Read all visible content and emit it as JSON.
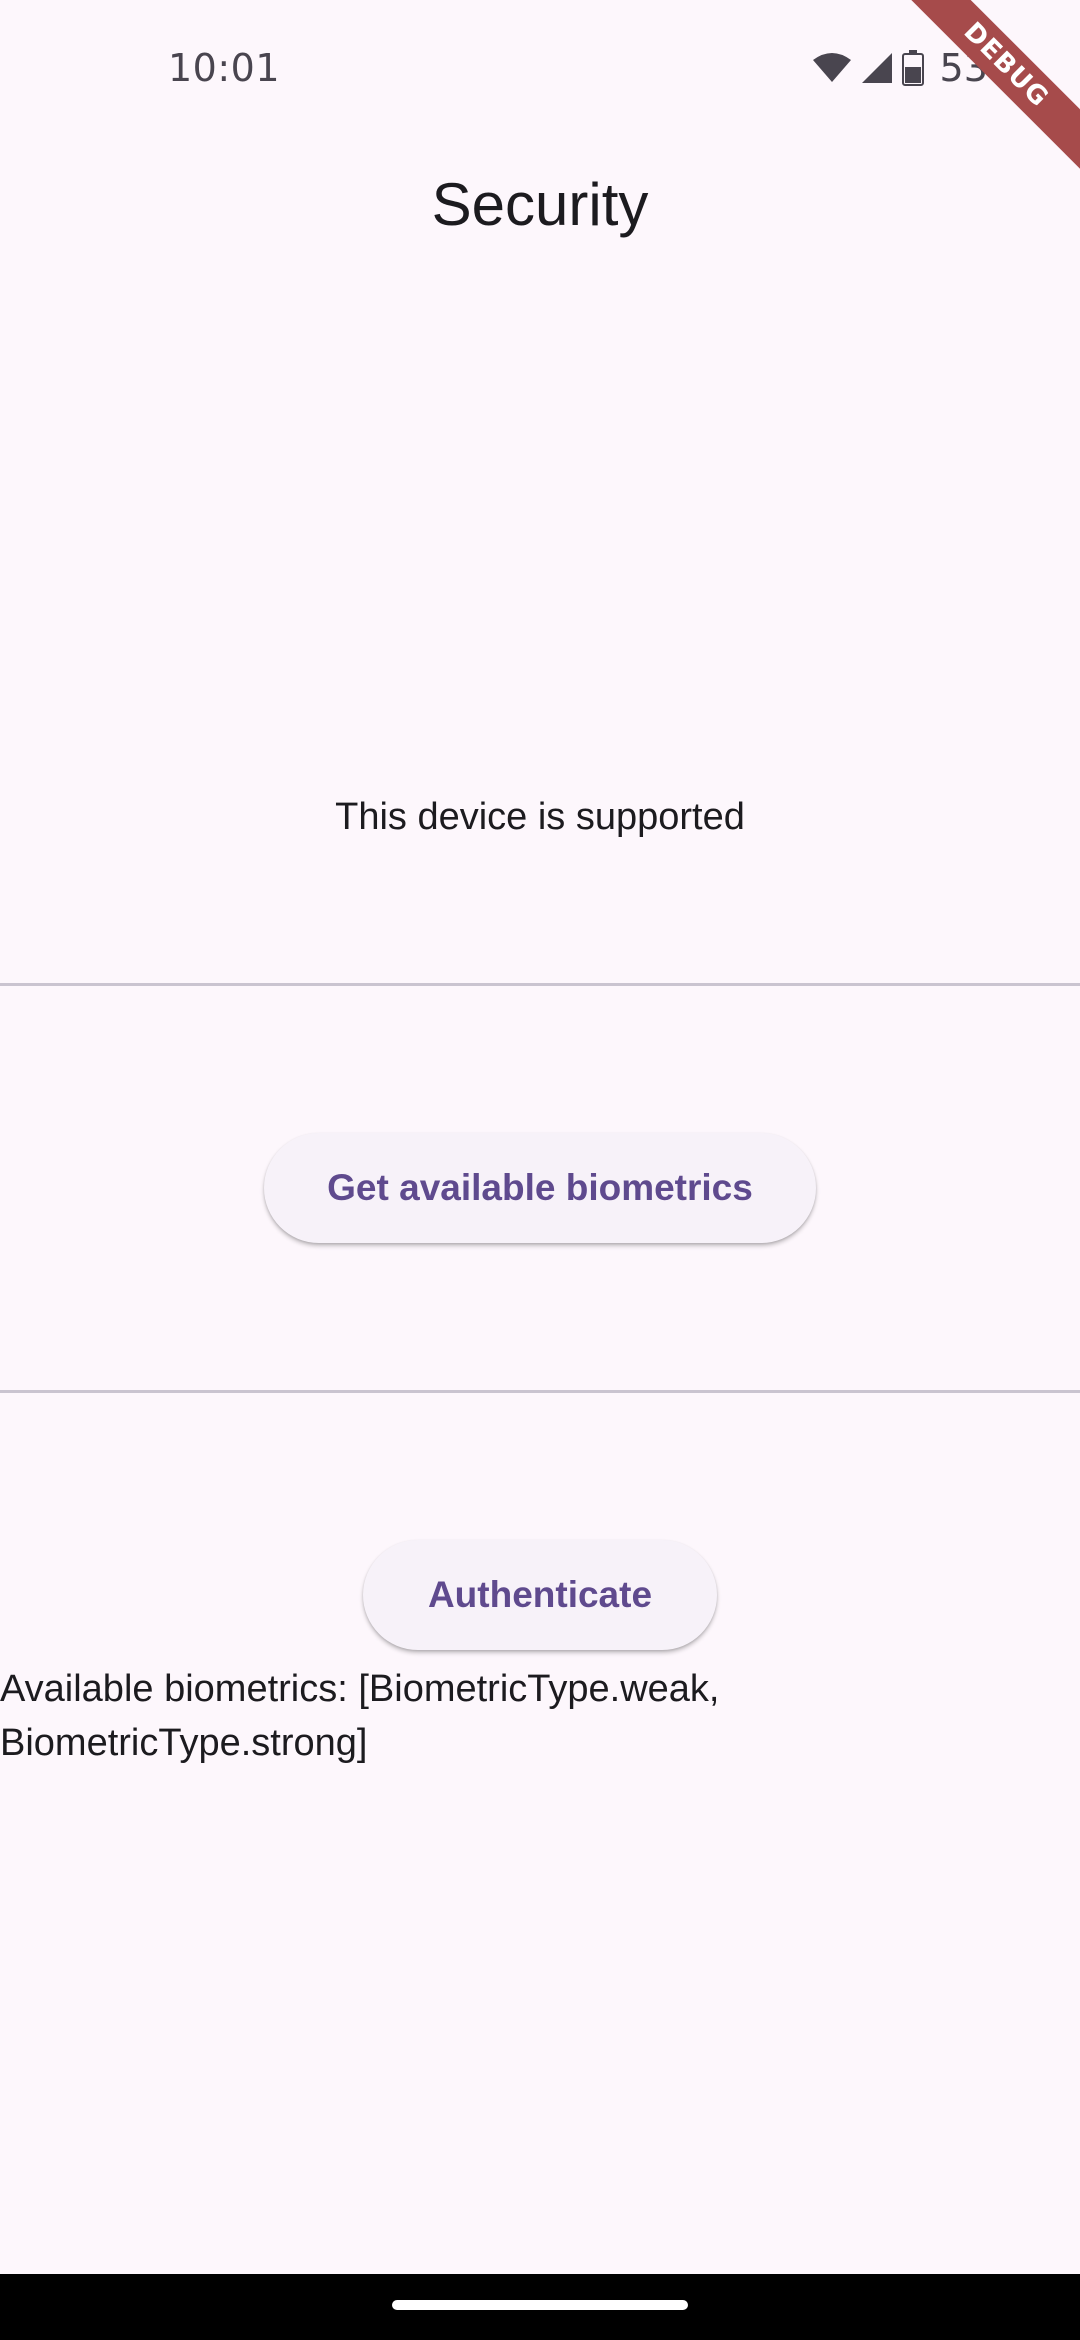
{
  "status_bar": {
    "time": "10:01",
    "battery": "53%",
    "icons": [
      "wifi-icon",
      "cellular-signal-icon",
      "battery-icon"
    ]
  },
  "debug_banner": "DEBUG",
  "app_bar": {
    "title": "Security"
  },
  "support_status": "This device is supported",
  "buttons": {
    "get_biometrics": "Get available biometrics",
    "authenticate": "Authenticate"
  },
  "result": {
    "line1": "Available biometrics: [BiometricType.weak,",
    "line2": "BiometricType.strong]"
  },
  "colors": {
    "background": "#fdf7fc",
    "button_text": "#6750a4",
    "button_bg": "#f7f2f9",
    "divider": "#cac4d0",
    "debug_ribbon": "#a64b4b"
  }
}
